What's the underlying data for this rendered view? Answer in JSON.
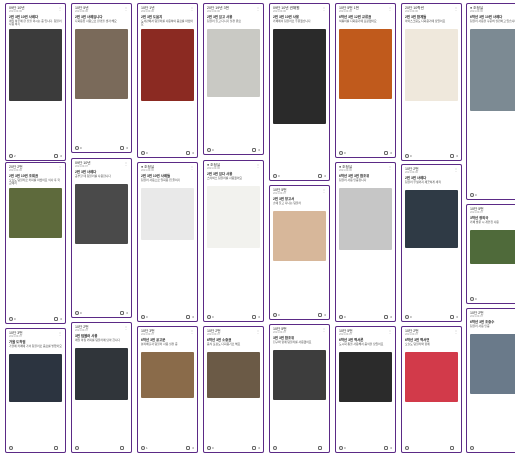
{
  "columns": [
    {
      "cards": [
        {
          "user": "09단 10년",
          "meta": "2021.09.06",
          "title": "2번 3번 10번 사레다",
          "body": "매일 하루에 한 잔을 마시는 중 입니다. 텀블러 사용 하기",
          "photo": "#3b3b3b",
          "likes": "2",
          "comments": "0"
        },
        {
          "user": "20단 2번",
          "meta": "2021.09.06",
          "title": "2번 3번 10번 조회권",
          "body": "오늘도 텀블러로 커피를 마셨어요 식사 후 학교에서",
          "photo": "#5e6a3c",
          "likes": "0",
          "comments": "0"
        },
        {
          "user": "10단 3번",
          "meta": "2021.09.07",
          "title": "가을 도착점",
          "body": "가을에 카페에 가서 텀블러로 음료를 받았어요",
          "photo": "#2c3440",
          "likes": "",
          "comments": ""
        }
      ]
    },
    {
      "cards": [
        {
          "user": "10단 5년",
          "meta": "2021.09.06",
          "title": "2번 3번 사례입니다",
          "body": "다회용컵 사용으로 환경을 생각 해요",
          "photo": "#7a6a5a",
          "likes": "0",
          "comments": "0"
        },
        {
          "user": "09단 10년",
          "meta": "2021.09.07",
          "title": "2번 3번 사레다",
          "body": "공부할 때 텀블러를 사용합니다",
          "photo": "#4a4a4a",
          "likes": "0",
          "comments": "0"
        },
        {
          "user": "10단 2번",
          "meta": "2021.09.07",
          "title": "3번 텀블러 사용",
          "body": "매일 아침 커피를 텀블러에 담아 갑니다",
          "photo": "#30353a",
          "likes": "",
          "comments": ""
        }
      ]
    },
    {
      "cards": [
        {
          "user": "10단 1년",
          "meta": "2021.09.06",
          "title": "2번 3번 도움지",
          "body": "도서관에서 텀블러를 사용하여 음료를 마셨어요",
          "photo": "#8b2a22",
          "likes": "0",
          "comments": "0"
        },
        {
          "user": "● 조정실",
          "meta": "2021.09.06",
          "title": "2번 3번 10번 사례들",
          "body": "텀블러 사용으로 일회용 컵 줄이기",
          "photo": "#e9e9e9",
          "likes": "0",
          "comments": "0"
        },
        {
          "user": "10단 3번",
          "meta": "2021.09.07",
          "title": "6학년 3번 공고문",
          "body": "분리배출과 텀블러 사용 실천 중",
          "photo": "#8a6b4a",
          "likes": "1",
          "comments": "0"
        }
      ]
    },
    {
      "cards": [
        {
          "user": "20단 19년 3번",
          "meta": "2021.09.06",
          "title": "2번 3번 있고 사용",
          "body": "텀블러 들고 다니기 실천 완료",
          "photo": "#c9c9c4",
          "likes": "0",
          "comments": "0"
        },
        {
          "user": "● 조정실",
          "meta": "2021.09.06",
          "title": "2번 3번 있다 사용",
          "body": "스타벅스 텀블러를 사용했어요",
          "photo": "#f2f2ee",
          "likes": "0",
          "comments": "0"
        },
        {
          "user": "10단 2번",
          "meta": "2021.09.07",
          "title": "6학년 3번 소중권",
          "body": "음식 포장도 다회용기로 해요",
          "photo": "#6b5a46",
          "likes": "0",
          "comments": "0"
        }
      ]
    },
    {
      "cards": [
        {
          "user": "09단 10년 권해원",
          "meta": "2021.09.06",
          "title": "2번 3번 10번 사용",
          "body": "카페에서 텀블러로 주문했습니다",
          "photo": "#2a2a2a",
          "likes": "0",
          "comments": "0"
        },
        {
          "user": "10단 5번",
          "meta": "2021.09.07",
          "title": "2번 3번 창고서",
          "body": "손에 들고 다니는 텀블러",
          "photo": "#d7b79a",
          "likes": "0",
          "comments": "0"
        },
        {
          "user": "10단 5번",
          "meta": "2021.09.07",
          "title": "3번 3번 합조위",
          "body": "친구와 함께 텀블러를 사용했어요",
          "photo": "#3d3d3d",
          "likes": "",
          "comments": ""
        }
      ]
    },
    {
      "cards": [
        {
          "user": "10단 5번 1번",
          "meta": "2021.09.06",
          "title": "6학년 3번 12번 교류권",
          "body": "떡볶이를 다회용기에 포장했어요",
          "photo": "#c05a1c",
          "likes": "0",
          "comments": "0"
        },
        {
          "user": "● 조정실",
          "meta": "2021.09.06",
          "title": "6학년 3번 3번 합조위",
          "body": "텀블러 사용 인증합니다",
          "photo": "#c6c6c6",
          "likes": "0",
          "comments": "0"
        },
        {
          "user": "10단 5번",
          "meta": "2021.09.07",
          "title": "6학년 3번 백서론",
          "body": "도시락 통을 사용해서 음식을 담았어요",
          "photo": "#2b2b2b",
          "likes": "0",
          "comments": "0"
        }
      ]
    },
    {
      "cards": [
        {
          "user": "20단 10학년",
          "meta": "2021.09.06",
          "title": "2번 3번 합계들",
          "body": "아이스크림도 다회용기에 담았어요",
          "photo": "#efe8dc",
          "likes": "0",
          "comments": "0"
        },
        {
          "user": "10단 2번",
          "meta": "2021.09.06",
          "title": "2번 3번 사레다",
          "body": "텀블러 뚜껑까지 깨끗하게 세척",
          "photo": "#2f3a45",
          "likes": "0",
          "comments": "0"
        },
        {
          "user": "10단 2번",
          "meta": "2021.09.07",
          "title": "6학년 3번 백서연",
          "body": "오늘도 텀블러와 함께",
          "photo": "#d23a4a",
          "likes": "",
          "comments": ""
        }
      ]
    },
    {
      "cards": [
        {
          "user": "● 조정실",
          "meta": "2021.09.06",
          "title": "6학년 3번 10번 사례다",
          "body": "텀블러 사용을 꾸준히 실천하고 있습니다",
          "photo": "#7c8a93",
          "likes": "0",
          "comments": "0"
        },
        {
          "user": "10단 5번",
          "meta": "2021.09.07",
          "title": "3학년 정외국",
          "body": "카페 방문 시 개인컵 사용",
          "photo": "#4f6a3a",
          "likes": "0",
          "comments": "0"
        },
        {
          "user": "10단 2번",
          "meta": "2021.09.07",
          "title": "6학년 3번 조중수",
          "body": "텀블러 사용 인증",
          "photo": "#6a7a8a",
          "likes": "",
          "comments": ""
        }
      ]
    }
  ]
}
